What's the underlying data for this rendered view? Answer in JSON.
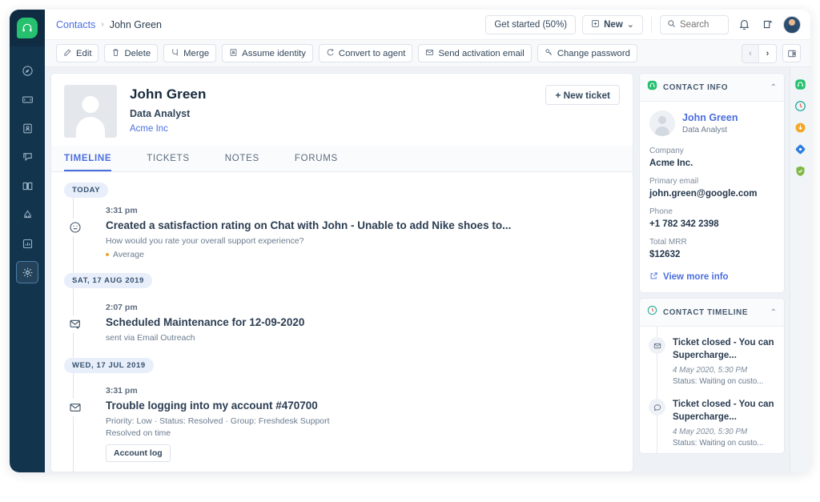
{
  "leftnav": {
    "brand": "freshdesk-logo",
    "items": [
      {
        "name": "dashboard",
        "icon": "compass-icon",
        "active": false
      },
      {
        "name": "tickets",
        "icon": "ticket-icon",
        "active": false
      },
      {
        "name": "contacts",
        "icon": "contact-card-icon",
        "active": false
      },
      {
        "name": "chat",
        "icon": "chat-icon",
        "active": false
      },
      {
        "name": "solutions",
        "icon": "book-icon",
        "active": false
      },
      {
        "name": "automations",
        "icon": "bell-icon",
        "active": false
      },
      {
        "name": "reports",
        "icon": "bar-chart-icon",
        "active": false
      },
      {
        "name": "admin",
        "icon": "gear-icon",
        "active": true
      }
    ]
  },
  "topbar": {
    "breadcrumb_root": "Contacts",
    "breadcrumb_sep": "›",
    "breadcrumb_current": "John Green",
    "get_started": "Get started (50%)",
    "new_button": "New",
    "new_caret": "⌄",
    "search_placeholder": "Search",
    "icons": [
      "search-icon",
      "bell-icon",
      "whats-new-icon",
      "user-avatar"
    ]
  },
  "actionbar": {
    "buttons": [
      {
        "label": "Edit",
        "icon": "pencil-square-icon"
      },
      {
        "label": "Delete",
        "icon": "trash-icon"
      },
      {
        "label": "Merge",
        "icon": "merge-icon"
      },
      {
        "label": "Assume identity",
        "icon": "identity-icon"
      },
      {
        "label": "Convert to agent",
        "icon": "convert-icon"
      },
      {
        "label": "Send activation email",
        "icon": "envelope-icon"
      },
      {
        "label": "Change password",
        "icon": "key-icon"
      }
    ],
    "prev": "‹",
    "next": "›",
    "panel_toggle": "layout-panel-icon"
  },
  "contact": {
    "name": "John Green",
    "role": "Data Analyst",
    "company_link": "Acme Inc",
    "new_ticket": "+ New ticket"
  },
  "tabs": [
    {
      "label": "TIMELINE",
      "active": true
    },
    {
      "label": "TICKETS",
      "active": false
    },
    {
      "label": "NOTES",
      "active": false
    },
    {
      "label": "FORUMS",
      "active": false
    }
  ],
  "timeline": [
    {
      "day": "TODAY",
      "time": "3:31 pm",
      "icon": "neutral-face-icon",
      "title": "Created a satisfaction rating on Chat with John - Unable to add Nike shoes to...",
      "subtitle": "How would you rate your overall support experience?",
      "rating": "Average",
      "rating_color": "#f0a32e"
    },
    {
      "day": "SAT, 17 AUG 2019",
      "time": "2:07 pm",
      "icon": "envelope-plus-icon",
      "title": "Scheduled Maintenance for 12-09-2020",
      "subtitle": "sent via Email Outreach"
    },
    {
      "day": "WED, 17 JUL 2019",
      "time": "3:31 pm",
      "icon": "envelope-icon",
      "title": "Trouble logging into my account #470700",
      "subtitle": "Priority: Low  ·  Status: Resolved  ·  Group: Freshdesk Support",
      "subtitle2": "Resolved on time",
      "log_button": "Account log"
    }
  ],
  "contact_info": {
    "card_title": "CONTACT INFO",
    "badge_icon": "freshdesk-badge-icon",
    "collapse": "⌃",
    "name": "John Green",
    "role": "Data Analyst",
    "fields": [
      {
        "label": "Company",
        "value": "Acme Inc."
      },
      {
        "label": "Primary email",
        "value": "john.green@google.com"
      },
      {
        "label": "Phone",
        "value": "+1 782 342 2398"
      },
      {
        "label": "Total MRR",
        "value": "$12632"
      }
    ],
    "more_link": "View more info",
    "more_icon": "external-link-icon"
  },
  "contact_timeline": {
    "card_title": "CONTACT TIMELINE",
    "badge_icon": "clock-icon",
    "collapse": "⌃",
    "items": [
      {
        "icon": "envelope-icon",
        "title": "Ticket closed - You can Supercharge...",
        "date": "4 May 2020, 5:30 PM",
        "status": "Status: Waiting on custo..."
      },
      {
        "icon": "chat-bubble-icon",
        "title": "Ticket closed - You can Supercharge...",
        "date": "4 May 2020, 5:30 PM",
        "status": "Status: Waiting on custo..."
      }
    ]
  },
  "rail": {
    "icons": [
      {
        "name": "freshdesk-app-icon",
        "color": "#25c16f"
      },
      {
        "name": "freshcaller-app-icon",
        "color": "#1aa896"
      },
      {
        "name": "freshsales-app-icon",
        "color": "#f5a623"
      },
      {
        "name": "freshchat-app-icon",
        "color": "#2f7de1"
      },
      {
        "name": "freshservice-app-icon",
        "color": "#7fb842"
      }
    ]
  },
  "colors": {
    "nav_bg": "#12344d",
    "brand_green": "#25c16f",
    "accent_blue": "#4a6ee0",
    "page_bg": "#eef1f5"
  }
}
